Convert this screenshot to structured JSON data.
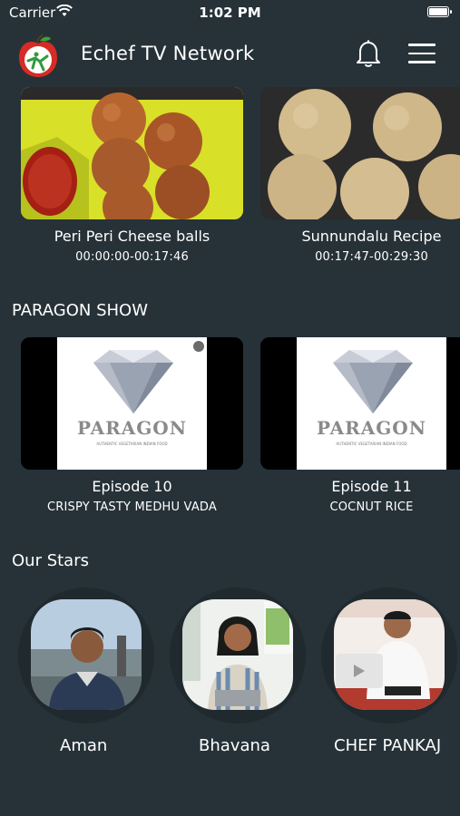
{
  "status_bar": {
    "carrier": "Carrier",
    "time": "1:02 PM"
  },
  "header": {
    "title": "Echef TV Network",
    "logo_icon": "echef-apple-logo",
    "notification_icon": "bell-icon",
    "menu_icon": "hamburger-menu-icon"
  },
  "recipes": [
    {
      "title": "Peri Peri Cheese balls",
      "timestamp": "00:00:00-00:17:46"
    },
    {
      "title": "Sunnundalu Recipe",
      "timestamp": "00:17:47-00:29:30"
    }
  ],
  "paragon_show": {
    "heading": "PARAGON SHOW",
    "thumbnail_text": "PARAGON",
    "thumbnail_tagline": "AUTHENTIC VEGETARIAN INDIAN FOOD",
    "episodes": [
      {
        "title": "Episode 10",
        "subtitle": "CRISPY TASTY MEDHU VADA"
      },
      {
        "title": "Episode 11",
        "subtitle": "COCNUT RICE"
      }
    ]
  },
  "our_stars": {
    "heading": "Our Stars",
    "stars": [
      {
        "name": "Aman"
      },
      {
        "name": "Bhavana"
      },
      {
        "name": "CHEF PANKAJ"
      }
    ]
  },
  "colors": {
    "background": "#263238",
    "ring": "#1f292e",
    "accent_yellow": "#d8e028",
    "accent_red": "#d72b25"
  }
}
